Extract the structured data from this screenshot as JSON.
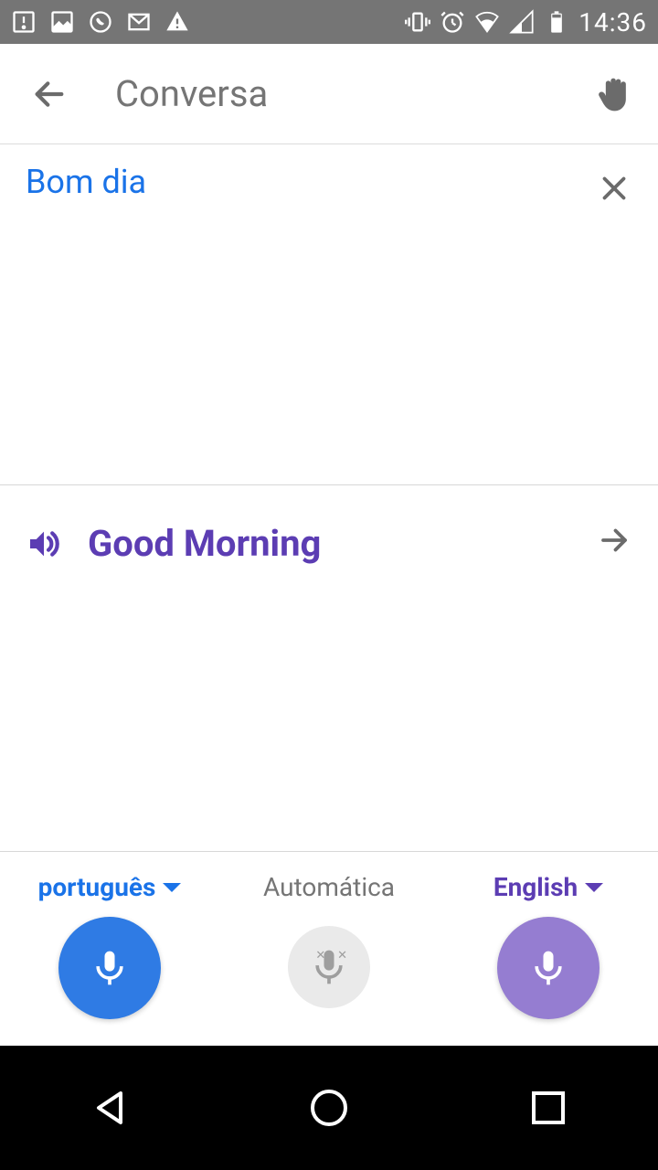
{
  "status": {
    "time": "14:36"
  },
  "appbar": {
    "title": "Conversa"
  },
  "source": {
    "text": "Bom dia"
  },
  "target": {
    "text": "Good Morning"
  },
  "controls": {
    "left_lang": "português",
    "center_label": "Automática",
    "right_lang": "English"
  }
}
